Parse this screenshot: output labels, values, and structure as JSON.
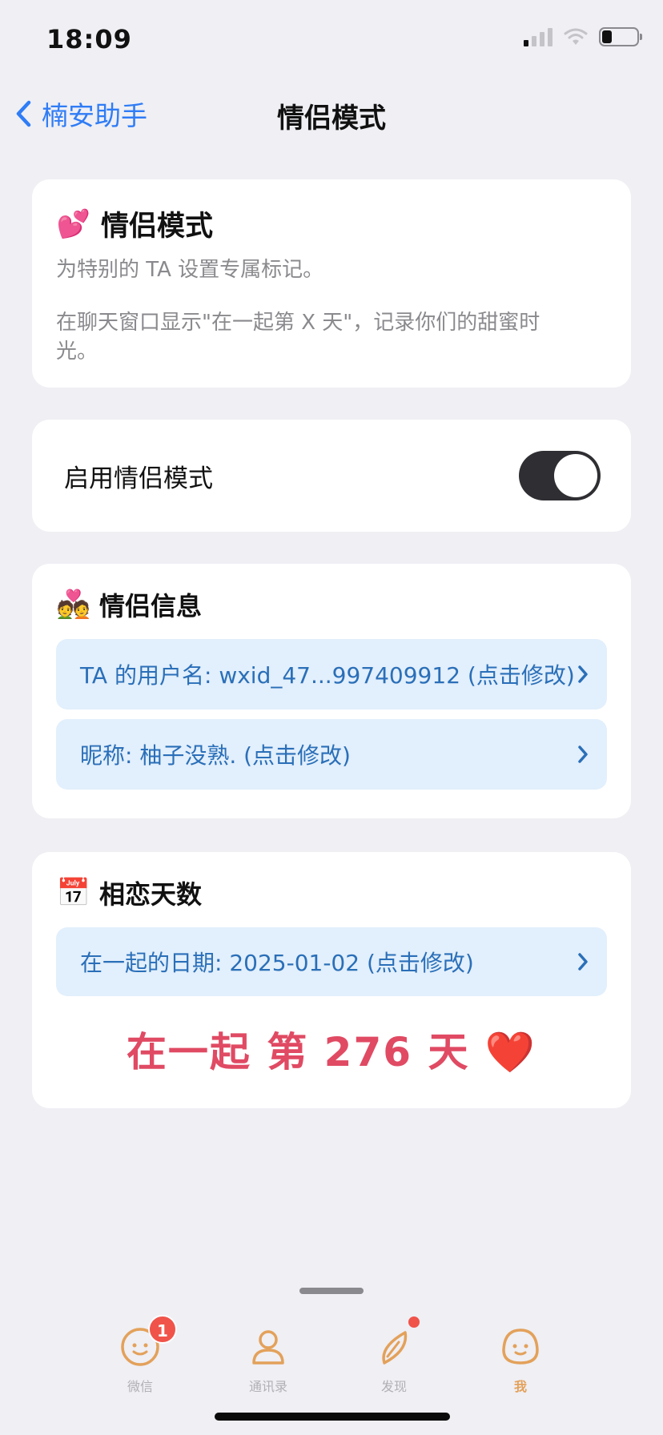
{
  "status_bar": {
    "time": "18:09"
  },
  "nav": {
    "back_label": "楠安助手",
    "title": "情侣模式"
  },
  "intro": {
    "emoji": "💕",
    "title": "情侣模式",
    "desc1": "为特别的 TA 设置专属标记。",
    "desc2": "在聊天窗口显示\"在一起第 X 天\"，记录你们的甜蜜时光。"
  },
  "toggle": {
    "label": "启用情侣模式",
    "enabled": true
  },
  "couple_info": {
    "emoji": "💑",
    "title": "情侣信息",
    "username_row": "TA 的用户名: wxid_47...997409912 (点击修改)",
    "nickname_row": "昵称: 柚子没熟. (点击修改)"
  },
  "days": {
    "emoji": "📅",
    "title": "相恋天数",
    "date_row": "在一起的日期: 2025-01-02 (点击修改)",
    "together_text": "在一起 第 276 天",
    "heart": "❤️"
  },
  "tab_bar": {
    "tabs": [
      {
        "label": "微信",
        "badge": "1",
        "icon": "chat-face-icon"
      },
      {
        "label": "通讯录",
        "icon": "contacts-person-icon"
      },
      {
        "label": "发现",
        "icon": "compass-icon"
      },
      {
        "label": "我",
        "icon": "me-face-icon",
        "active": true
      }
    ]
  },
  "colors": {
    "accent": "#2f7cf6",
    "row_bg": "#e2effc",
    "row_text": "#2a6fb8",
    "highlight": "#e04a63",
    "tab_active": "#e3a15a"
  }
}
